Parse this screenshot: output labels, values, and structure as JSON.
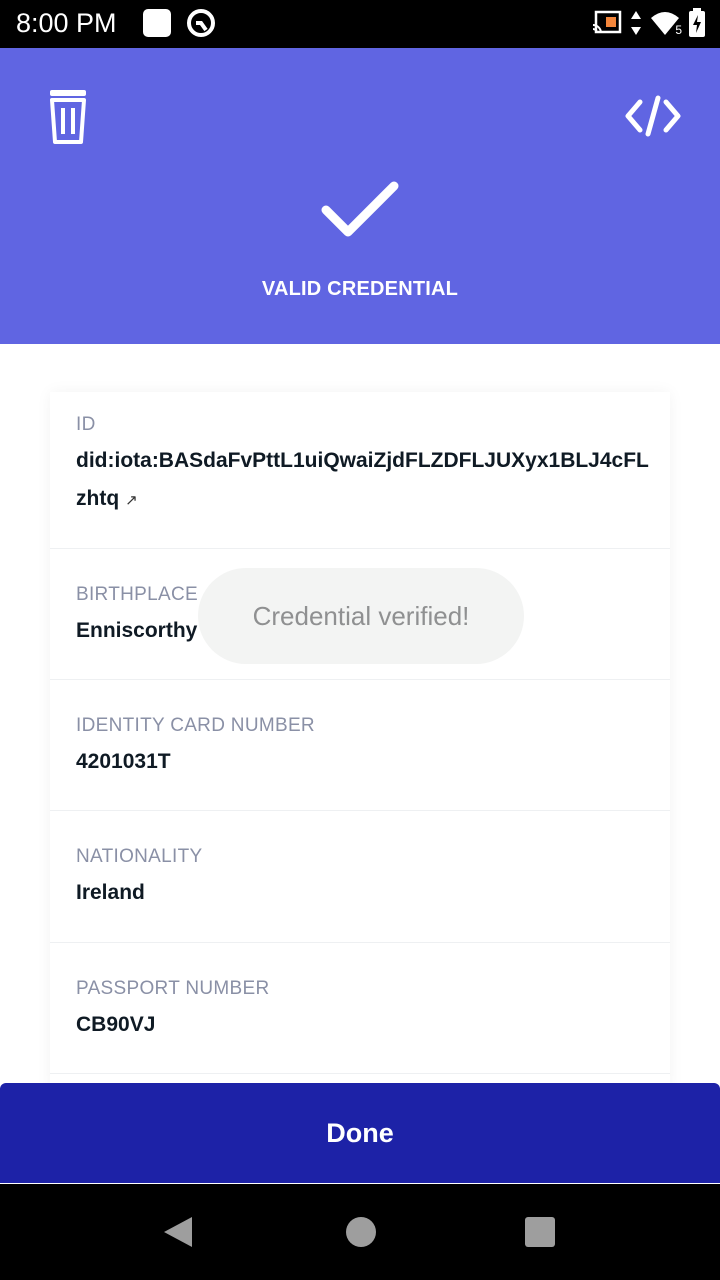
{
  "status_bar": {
    "time": "8:00 PM",
    "left_icons": [
      "square-notification-icon",
      "circle-notification-icon"
    ],
    "right_icons": [
      "cast-icon",
      "data-arrows-icon",
      "wifi-icon",
      "battery-charging-icon"
    ],
    "wifi_badge": "5"
  },
  "header": {
    "title": "VALID CREDENTIAL",
    "background": "#6065e2",
    "left_action_icon": "trash-icon",
    "right_action_icon": "code-icon",
    "status_icon": "checkmark-icon"
  },
  "fields": [
    {
      "label": "ID",
      "value": "did:iota:BASdaFvPttL1uiQwaiZjdFLZDFLJUXyx1BLJ4cFLzhtq",
      "link_icon": "↗"
    },
    {
      "label": "BIRTHPLACE",
      "value": "Enniscorthy"
    },
    {
      "label": "IDENTITY CARD NUMBER",
      "value": "4201031T"
    },
    {
      "label": "NATIONALITY",
      "value": "Ireland"
    },
    {
      "label": "PASSPORT NUMBER",
      "value": "CB90VJ"
    }
  ],
  "toast": {
    "text": "Credential verified!"
  },
  "done_button": {
    "label": "Done",
    "color": "#1d22a7"
  }
}
